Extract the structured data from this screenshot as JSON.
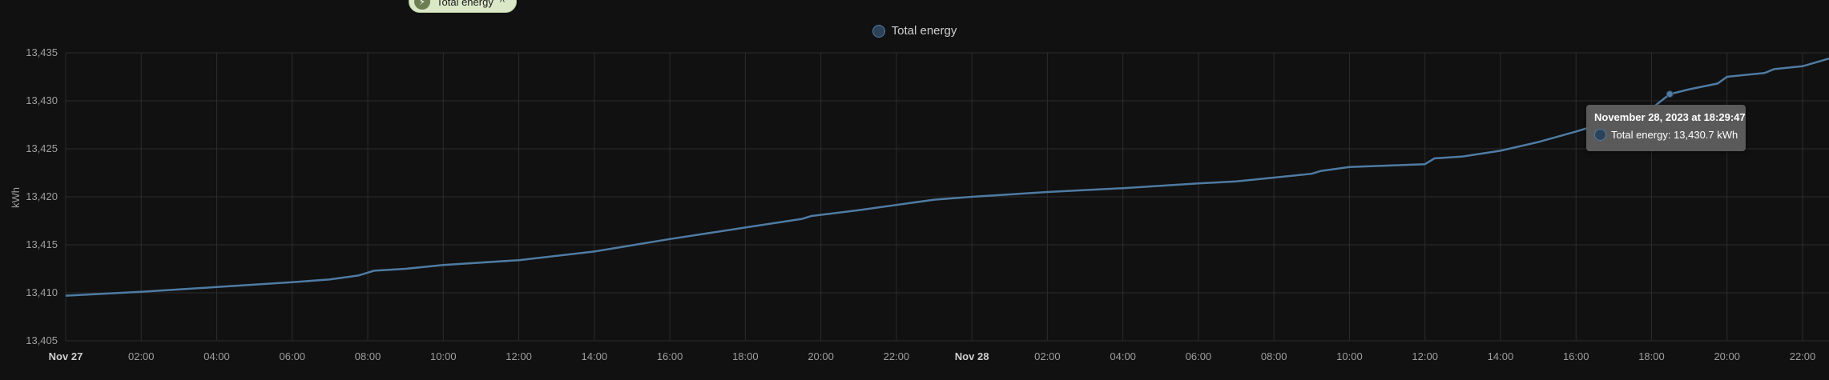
{
  "chip": {
    "label": "Total energy",
    "close_symbol": "^"
  },
  "chart_data": {
    "type": "line",
    "title": "",
    "ylabel": "kWh",
    "ylim": [
      13405,
      13435
    ],
    "xlim": [
      "2023-11-27T00:00",
      "2023-11-28T23:30"
    ],
    "y_ticks": [
      "13,405",
      "13,410",
      "13,415",
      "13,420",
      "13,425",
      "13,430",
      "13,435"
    ],
    "x_ticks": [
      "Nov 27",
      "02:00",
      "04:00",
      "06:00",
      "08:00",
      "10:00",
      "12:00",
      "14:00",
      "16:00",
      "18:00",
      "20:00",
      "22:00",
      "Nov 28",
      "02:00",
      "04:00",
      "06:00",
      "08:00",
      "10:00",
      "12:00",
      "14:00",
      "16:00",
      "18:00",
      "20:00",
      "22:00"
    ],
    "grid": true,
    "legend_position": "top-center",
    "colors": {
      "line": "#4f7ba3",
      "background": "#111111",
      "grid": "#2c2c2c"
    },
    "series": [
      {
        "name": "Total energy",
        "x": [
          "2023-11-27T00:00",
          "2023-11-27T02:00",
          "2023-11-27T04:00",
          "2023-11-27T06:00",
          "2023-11-27T07:00",
          "2023-11-27T07:45",
          "2023-11-27T08:10",
          "2023-11-27T09:00",
          "2023-11-27T10:00",
          "2023-11-27T12:00",
          "2023-11-27T14:00",
          "2023-11-27T16:00",
          "2023-11-27T18:00",
          "2023-11-27T19:30",
          "2023-11-27T19:45",
          "2023-11-27T21:00",
          "2023-11-27T23:00",
          "2023-11-28T00:00",
          "2023-11-28T02:00",
          "2023-11-28T04:00",
          "2023-11-28T06:00",
          "2023-11-28T07:00",
          "2023-11-28T08:00",
          "2023-11-28T09:00",
          "2023-11-28T09:15",
          "2023-11-28T10:00",
          "2023-11-28T12:00",
          "2023-11-28T12:15",
          "2023-11-28T13:00",
          "2023-11-28T14:00",
          "2023-11-28T15:00",
          "2023-11-28T16:00",
          "2023-11-28T17:00",
          "2023-11-28T18:00",
          "2023-11-28T18:29",
          "2023-11-28T19:00",
          "2023-11-28T19:45",
          "2023-11-28T20:00",
          "2023-11-28T21:00",
          "2023-11-28T21:15",
          "2023-11-28T22:00",
          "2023-11-28T23:30"
        ],
        "values": [
          13409.7,
          13410.1,
          13410.6,
          13411.1,
          13411.4,
          13411.8,
          13412.3,
          13412.5,
          13412.9,
          13413.4,
          13414.3,
          13415.6,
          13416.8,
          13417.7,
          13418.0,
          13418.6,
          13419.7,
          13420.0,
          13420.5,
          13420.9,
          13421.4,
          13421.6,
          13422.0,
          13422.4,
          13422.7,
          13423.1,
          13423.4,
          13424.0,
          13424.2,
          13424.8,
          13425.7,
          13426.8,
          13428.0,
          13429.2,
          13430.7,
          13431.2,
          13431.8,
          13432.5,
          13432.9,
          13433.3,
          13433.6,
          13434.4
        ]
      }
    ],
    "tooltip": {
      "title": "November 28, 2023 at 18:29:47",
      "series_name": "Total energy",
      "value_text": "Total energy: 13,430.7 kWh",
      "x": "2023-11-28T18:29",
      "y": 13430.7
    }
  }
}
